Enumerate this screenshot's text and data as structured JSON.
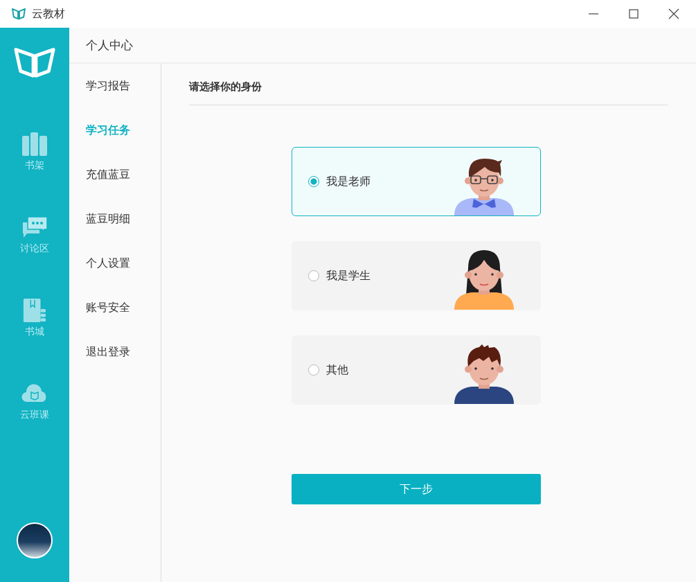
{
  "window": {
    "title": "云教材"
  },
  "rail": {
    "items": [
      {
        "kind": "shelf",
        "label": "书架"
      },
      {
        "kind": "chat",
        "label": "讨论区"
      },
      {
        "kind": "store",
        "label": "书城"
      },
      {
        "kind": "cloud",
        "label": "云班课"
      }
    ]
  },
  "header": {
    "title": "个人中心"
  },
  "menu": {
    "items": [
      {
        "label": "学习报告",
        "selected": false
      },
      {
        "label": "学习任务",
        "selected": true
      },
      {
        "label": "充值蓝豆",
        "selected": false
      },
      {
        "label": "蓝豆明细",
        "selected": false
      },
      {
        "label": "个人设置",
        "selected": false
      },
      {
        "label": "账号安全",
        "selected": false
      },
      {
        "label": "退出登录",
        "selected": false
      }
    ]
  },
  "content": {
    "heading": "请选择你的身份",
    "options": [
      {
        "label": "我是老师",
        "selected": true,
        "kind": "teacher",
        "color": "#a8b8f8"
      },
      {
        "label": "我是学生",
        "selected": false,
        "kind": "student",
        "color": "#ffaa50"
      },
      {
        "label": "其他",
        "selected": false,
        "kind": "other",
        "color": "#2b4580"
      }
    ],
    "next_button": "下一步"
  }
}
